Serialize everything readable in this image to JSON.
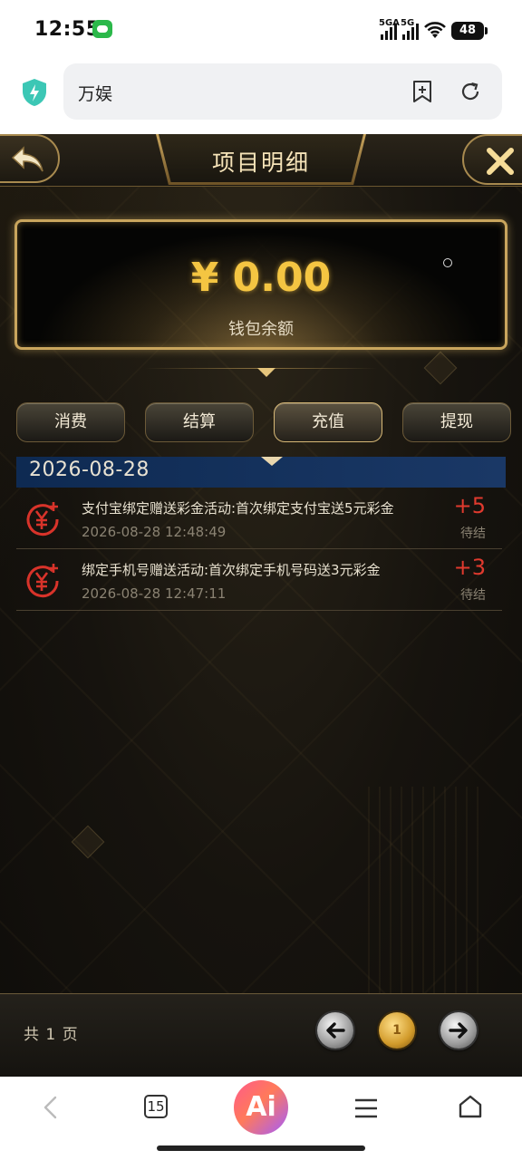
{
  "status_bar": {
    "time": "12:55",
    "network_1": "5GA",
    "network_2": "5G",
    "battery": "48"
  },
  "browser": {
    "address_text": "万娱",
    "tab_count": "15",
    "ai_label": "Ai"
  },
  "page": {
    "title": "项目明细"
  },
  "wallet": {
    "amount": "¥ 0.00",
    "label": "钱包余额"
  },
  "tabs": [
    {
      "label": "消费"
    },
    {
      "label": "结算"
    },
    {
      "label": "充值"
    },
    {
      "label": "提现"
    }
  ],
  "date_group": "2026-08-28",
  "records": [
    {
      "title": "支付宝绑定赠送彩金活动:首次绑定支付宝送5元彩金",
      "time": "2026-08-28 12:48:49",
      "amount": "+5",
      "status": "待结"
    },
    {
      "title": "绑定手机号赠送活动:首次绑定手机号码送3元彩金",
      "time": "2026-08-28 12:47:11",
      "amount": "+3",
      "status": "待结"
    }
  ],
  "pagination": {
    "total_text": "共 1 页",
    "current_page": "1"
  },
  "colors": {
    "gold": "#c9a55d",
    "amount_yellow": "#f4c542",
    "record_red": "#e03a2e",
    "date_header_blue": "#0e2a52"
  }
}
